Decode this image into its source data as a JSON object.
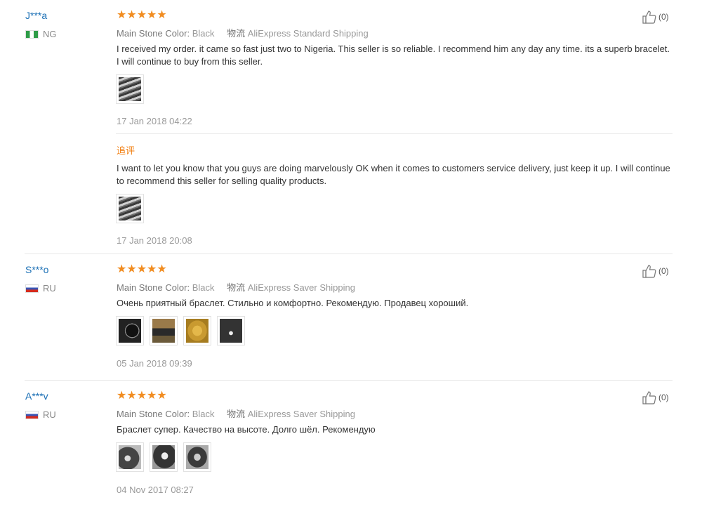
{
  "reviews": [
    {
      "user": "J***a",
      "country": "NG",
      "stars": "★★★★★",
      "meta_label": "Main Stone Color:",
      "meta_value": "Black",
      "ship_label": "物流",
      "ship_value": "AliExpress Standard Shipping",
      "text": "I received my order. it came so fast just two to Nigeria. This seller is so reliable. I recommend him any day any time. its a superb bracelet. I will continue to buy from this seller.",
      "date": "17 Jan 2018 04:22",
      "helpful_count": "(0)",
      "additional": {
        "label": "追评",
        "text": "I want to let you know that you guys are doing marvelously OK when it comes to customers service delivery, just keep it up. I will continue to recommend this seller for selling quality products.",
        "date": "17 Jan 2018 20:08"
      }
    },
    {
      "user": "S***o",
      "country": "RU",
      "stars": "★★★★★",
      "meta_label": "Main Stone Color:",
      "meta_value": "Black",
      "ship_label": "物流",
      "ship_value": "AliExpress Saver Shipping",
      "text": "Очень приятный браслет. Стильно и комфортно. Рекомендую. Продавец хороший.",
      "date": "05 Jan 2018 09:39",
      "helpful_count": "(0)"
    },
    {
      "user": "A***v",
      "country": "RU",
      "stars": "★★★★★",
      "meta_label": "Main Stone Color:",
      "meta_value": "Black",
      "ship_label": "物流",
      "ship_value": "AliExpress Saver Shipping",
      "text": "Браслет супер. Качество на высоте. Долго шёл. Рекомендую",
      "date": "04 Nov 2017 08:27",
      "helpful_count": "(0)"
    }
  ],
  "colors": {
    "star": "#f18c20",
    "username": "#1a6fb5",
    "additional_label": "#f17c0c"
  }
}
